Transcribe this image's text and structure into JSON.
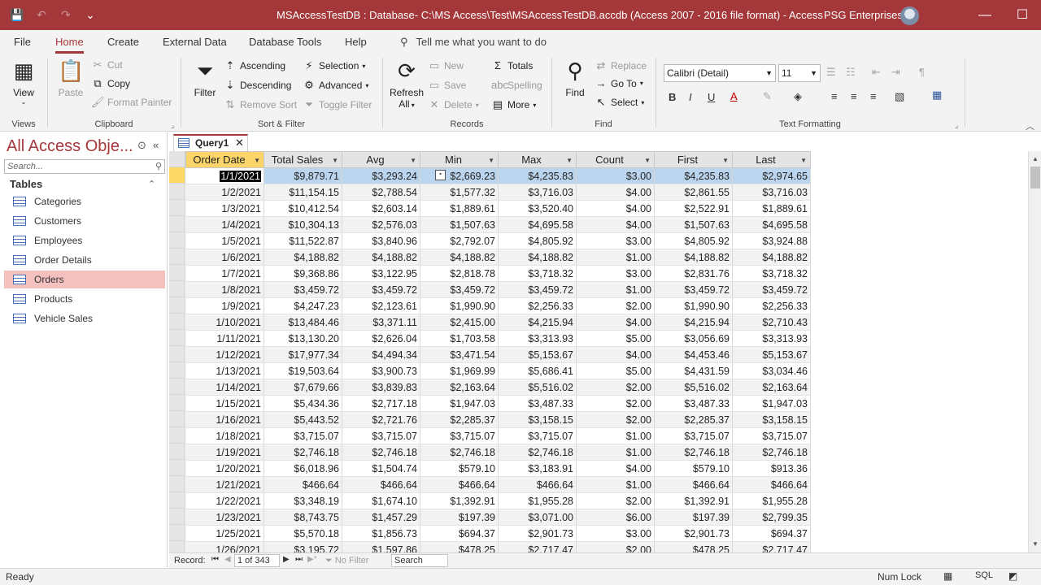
{
  "titlebar": {
    "title": "MSAccessTestDB : Database- C:\\MS Access\\Test\\MSAccessTestDB.accdb (Access 2007 - 2016 file format)  -  Access",
    "user": "PSG Enterprises",
    "minimize": "—",
    "maximize": "☐",
    "close": "✕"
  },
  "ribbon_tabs": [
    "File",
    "Home",
    "Create",
    "External Data",
    "Database Tools",
    "Help"
  ],
  "tell_me": "Tell me what you want to do",
  "ribbon": {
    "views": {
      "view": "View",
      "group": "Views"
    },
    "clipboard": {
      "paste": "Paste",
      "cut": "Cut",
      "copy": "Copy",
      "format_painter": "Format Painter",
      "group": "Clipboard"
    },
    "sort_filter": {
      "filter": "Filter",
      "ascending": "Ascending",
      "descending": "Descending",
      "remove_sort": "Remove Sort",
      "selection": "Selection",
      "advanced": "Advanced",
      "toggle_filter": "Toggle Filter",
      "group": "Sort & Filter"
    },
    "records": {
      "refresh": "Refresh",
      "refresh_all": "All",
      "new": "New",
      "save": "Save",
      "delete": "Delete",
      "totals": "Totals",
      "spelling": "Spelling",
      "more": "More",
      "group": "Records"
    },
    "find": {
      "find": "Find",
      "replace": "Replace",
      "goto": "Go To",
      "select": "Select",
      "group": "Find"
    },
    "text_formatting": {
      "font": "Calibri (Detail)",
      "size": "11",
      "group": "Text Formatting"
    }
  },
  "nav": {
    "title": "All Access Obje...",
    "search_placeholder": "Search...",
    "section": "Tables",
    "items": [
      "Categories",
      "Customers",
      "Employees",
      "Order Details",
      "Orders",
      "Products",
      "Vehicle Sales"
    ],
    "selected": "Orders"
  },
  "document_tab": "Query1",
  "datasheet": {
    "columns": [
      "Order Date",
      "Total Sales",
      "Avg",
      "Min",
      "Max",
      "Count",
      "First",
      "Last"
    ],
    "rows": [
      [
        "1/1/2021",
        "$9,879.71",
        "$3,293.24",
        "$2,669.23",
        "$4,235.83",
        "$3.00",
        "$4,235.83",
        "$2,974.65"
      ],
      [
        "1/2/2021",
        "$11,154.15",
        "$2,788.54",
        "$1,577.32",
        "$3,716.03",
        "$4.00",
        "$2,861.55",
        "$3,716.03"
      ],
      [
        "1/3/2021",
        "$10,412.54",
        "$2,603.14",
        "$1,889.61",
        "$3,520.40",
        "$4.00",
        "$2,522.91",
        "$1,889.61"
      ],
      [
        "1/4/2021",
        "$10,304.13",
        "$2,576.03",
        "$1,507.63",
        "$4,695.58",
        "$4.00",
        "$1,507.63",
        "$4,695.58"
      ],
      [
        "1/5/2021",
        "$11,522.87",
        "$3,840.96",
        "$2,792.07",
        "$4,805.92",
        "$3.00",
        "$4,805.92",
        "$3,924.88"
      ],
      [
        "1/6/2021",
        "$4,188.82",
        "$4,188.82",
        "$4,188.82",
        "$4,188.82",
        "$1.00",
        "$4,188.82",
        "$4,188.82"
      ],
      [
        "1/7/2021",
        "$9,368.86",
        "$3,122.95",
        "$2,818.78",
        "$3,718.32",
        "$3.00",
        "$2,831.76",
        "$3,718.32"
      ],
      [
        "1/8/2021",
        "$3,459.72",
        "$3,459.72",
        "$3,459.72",
        "$3,459.72",
        "$1.00",
        "$3,459.72",
        "$3,459.72"
      ],
      [
        "1/9/2021",
        "$4,247.23",
        "$2,123.61",
        "$1,990.90",
        "$2,256.33",
        "$2.00",
        "$1,990.90",
        "$2,256.33"
      ],
      [
        "1/10/2021",
        "$13,484.46",
        "$3,371.11",
        "$2,415.00",
        "$4,215.94",
        "$4.00",
        "$4,215.94",
        "$2,710.43"
      ],
      [
        "1/11/2021",
        "$13,130.20",
        "$2,626.04",
        "$1,703.58",
        "$3,313.93",
        "$5.00",
        "$3,056.69",
        "$3,313.93"
      ],
      [
        "1/12/2021",
        "$17,977.34",
        "$4,494.34",
        "$3,471.54",
        "$5,153.67",
        "$4.00",
        "$4,453.46",
        "$5,153.67"
      ],
      [
        "1/13/2021",
        "$19,503.64",
        "$3,900.73",
        "$1,969.99",
        "$5,686.41",
        "$5.00",
        "$4,431.59",
        "$3,034.46"
      ],
      [
        "1/14/2021",
        "$7,679.66",
        "$3,839.83",
        "$2,163.64",
        "$5,516.02",
        "$2.00",
        "$5,516.02",
        "$2,163.64"
      ],
      [
        "1/15/2021",
        "$5,434.36",
        "$2,717.18",
        "$1,947.03",
        "$3,487.33",
        "$2.00",
        "$3,487.33",
        "$1,947.03"
      ],
      [
        "1/16/2021",
        "$5,443.52",
        "$2,721.76",
        "$2,285.37",
        "$3,158.15",
        "$2.00",
        "$2,285.37",
        "$3,158.15"
      ],
      [
        "1/18/2021",
        "$3,715.07",
        "$3,715.07",
        "$3,715.07",
        "$3,715.07",
        "$1.00",
        "$3,715.07",
        "$3,715.07"
      ],
      [
        "1/19/2021",
        "$2,746.18",
        "$2,746.18",
        "$2,746.18",
        "$2,746.18",
        "$1.00",
        "$2,746.18",
        "$2,746.18"
      ],
      [
        "1/20/2021",
        "$6,018.96",
        "$1,504.74",
        "$579.10",
        "$3,183.91",
        "$4.00",
        "$579.10",
        "$913.36"
      ],
      [
        "1/21/2021",
        "$466.64",
        "$466.64",
        "$466.64",
        "$466.64",
        "$1.00",
        "$466.64",
        "$466.64"
      ],
      [
        "1/22/2021",
        "$3,348.19",
        "$1,674.10",
        "$1,392.91",
        "$1,955.28",
        "$2.00",
        "$1,392.91",
        "$1,955.28"
      ],
      [
        "1/23/2021",
        "$8,743.75",
        "$1,457.29",
        "$197.39",
        "$3,071.00",
        "$6.00",
        "$197.39",
        "$2,799.35"
      ],
      [
        "1/25/2021",
        "$5,570.18",
        "$1,856.73",
        "$694.37",
        "$2,901.73",
        "$3.00",
        "$2,901.73",
        "$694.37"
      ],
      [
        "1/26/2021",
        "$3,195.72",
        "$1,597.86",
        "$478.25",
        "$2,717.47",
        "$2.00",
        "$478.25",
        "$2,717.47"
      ]
    ]
  },
  "record_nav": {
    "label": "Record:",
    "position": "1 of 343",
    "no_filter": "No Filter",
    "search": "Search"
  },
  "status": {
    "ready": "Ready",
    "num_lock": "Num Lock",
    "sql": "SQL"
  }
}
